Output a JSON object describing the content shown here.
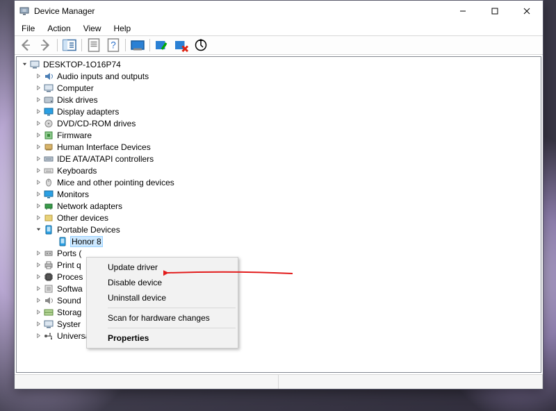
{
  "window": {
    "title": "Device Manager",
    "controls": {
      "minimize": "Minimize",
      "maximize": "Maximize",
      "close": "Close"
    }
  },
  "menubar": [
    "File",
    "Action",
    "View",
    "Help"
  ],
  "toolbar": [
    {
      "name": "back",
      "disabled": true
    },
    {
      "name": "forward",
      "disabled": true
    },
    {
      "name": "show-hide-console-tree",
      "disabled": false
    },
    {
      "name": "help",
      "disabled": false
    },
    {
      "name": "update-driver",
      "disabled": false
    },
    {
      "name": "disable-device",
      "disabled": false
    },
    {
      "name": "uninstall-device",
      "disabled": false
    },
    {
      "name": "scan-hardware",
      "disabled": false
    }
  ],
  "tree": {
    "root": "DESKTOP-1O16P74",
    "categories": [
      {
        "label": "Audio inputs and outputs",
        "icon": "audio"
      },
      {
        "label": "Computer",
        "icon": "computer"
      },
      {
        "label": "Disk drives",
        "icon": "disk"
      },
      {
        "label": "Display adapters",
        "icon": "display"
      },
      {
        "label": "DVD/CD-ROM drives",
        "icon": "dvd"
      },
      {
        "label": "Firmware",
        "icon": "firmware"
      },
      {
        "label": "Human Interface Devices",
        "icon": "hid"
      },
      {
        "label": "IDE ATA/ATAPI controllers",
        "icon": "ide"
      },
      {
        "label": "Keyboards",
        "icon": "keyboard"
      },
      {
        "label": "Mice and other pointing devices",
        "icon": "mouse"
      },
      {
        "label": "Monitors",
        "icon": "monitor"
      },
      {
        "label": "Network adapters",
        "icon": "network"
      },
      {
        "label": "Other devices",
        "icon": "other"
      },
      {
        "label": "Portable Devices",
        "icon": "portable",
        "expanded": true,
        "children": [
          {
            "label": "Honor 8",
            "icon": "portable",
            "selected": true
          }
        ]
      },
      {
        "label": "Ports (",
        "icon": "ports"
      },
      {
        "label": "Print q",
        "icon": "print"
      },
      {
        "label": "Proces",
        "icon": "processor"
      },
      {
        "label": "Softwa",
        "icon": "software"
      },
      {
        "label": "Sound",
        "icon": "sound"
      },
      {
        "label": "Storag",
        "icon": "storage"
      },
      {
        "label": "Syster",
        "icon": "system"
      },
      {
        "label": "Universal Serial Bus controllers",
        "icon": "usb"
      }
    ]
  },
  "context_menu": {
    "items": [
      {
        "label": "Update driver"
      },
      {
        "label": "Disable device"
      },
      {
        "label": "Uninstall device"
      },
      {
        "sep": true
      },
      {
        "label": "Scan for hardware changes"
      },
      {
        "sep": true
      },
      {
        "label": "Properties",
        "bold": true
      }
    ]
  },
  "annotation": {
    "arrow_target": "Update driver",
    "arrow_color": "#e21b1b"
  }
}
